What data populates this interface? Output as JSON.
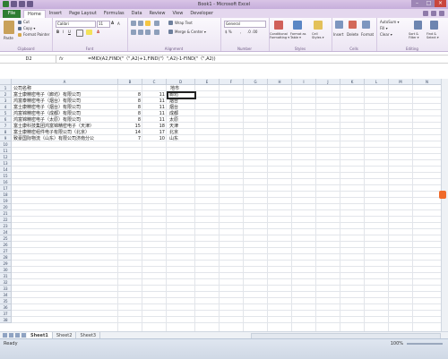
{
  "window": {
    "title": "Book1 - Microsoft Excel"
  },
  "tabs": {
    "file": "File",
    "items": [
      "Home",
      "Insert",
      "Page Layout",
      "Formulas",
      "Data",
      "Review",
      "View",
      "Developer"
    ]
  },
  "ribbon": {
    "clipboard": {
      "label": "Clipboard",
      "paste": "Paste",
      "cut": "Cut",
      "copy": "Copy ▾",
      "format_painter": "Format Painter"
    },
    "font": {
      "label": "Font",
      "font_name": "Calibri",
      "font_size": "11"
    },
    "alignment": {
      "label": "Alignment",
      "wrap": "Wrap Text",
      "merge": "Merge & Center ▾"
    },
    "number": {
      "label": "Number",
      "format": "General"
    },
    "styles": {
      "label": "Styles",
      "conditional": "Conditional Formatting ▾",
      "format_table": "Format as Table ▾",
      "cell_styles": "Cell Styles ▾"
    },
    "cells": {
      "label": "Cells",
      "insert": "Insert",
      "delete": "Delete",
      "format": "Format"
    },
    "editing": {
      "label": "Editing",
      "autosum": "AutoSum ▾",
      "fill": "Fill ▾",
      "clear": "Clear ▾",
      "sort": "Sort & Filter ▾",
      "find": "Find & Select ▾"
    }
  },
  "formula_bar": {
    "name_box": "D2",
    "fx": "fx",
    "formula": "=MID(A2,FIND(\"（\",A2)+1,FIND(\"）\",A2)-1-FIND(\"（\",A2))"
  },
  "columns": [
    "A",
    "B",
    "C",
    "D",
    "E",
    "F",
    "G",
    "H",
    "I",
    "J",
    "K",
    "L",
    "M",
    "N"
  ],
  "rows": [
    "1",
    "2",
    "3",
    "4",
    "5",
    "6",
    "7",
    "8",
    "9",
    "10",
    "11",
    "12",
    "13",
    "14",
    "15",
    "16",
    "17",
    "18",
    "19",
    "20",
    "21",
    "22",
    "23",
    "24",
    "25",
    "26",
    "27",
    "28",
    "29",
    "30",
    "31",
    "32",
    "33",
    "34",
    "35",
    "36",
    "37",
    "38"
  ],
  "cells": [
    {
      "a": "公司名称",
      "b": "",
      "c": "",
      "d": "地市"
    },
    {
      "a": "富士康精密电子（廊坊）有限公司",
      "b": "8",
      "c": "11",
      "d": "廊坊"
    },
    {
      "a": "鸿富泰精密电子（烟台）有限公司",
      "b": "8",
      "c": "11",
      "d": "烟台"
    },
    {
      "a": "富士康精密电子（烟台）有限公司",
      "b": "8",
      "c": "11",
      "d": "烟台"
    },
    {
      "a": "鸿富锦精密电子（成都）有限公司",
      "b": "8",
      "c": "11",
      "d": "成都"
    },
    {
      "a": "鸿富锦精密电子（太原）有限公司",
      "b": "8",
      "c": "11",
      "d": "太原"
    },
    {
      "a": "富士康科技集团鸿富锦精密电子（天津）",
      "b": "15",
      "c": "18",
      "d": "天津"
    },
    {
      "a": "富士康精密组件电子有限公司（北京）",
      "b": "14",
      "c": "17",
      "d": "北京"
    },
    {
      "a": "致豪国际物流（山东）有限公司济南分公",
      "b": "7",
      "c": "10",
      "d": "山东"
    }
  ],
  "sheets": [
    "Sheet1",
    "Sheet2",
    "Sheet3"
  ],
  "status": {
    "ready": "Ready",
    "zoom": "100%"
  }
}
